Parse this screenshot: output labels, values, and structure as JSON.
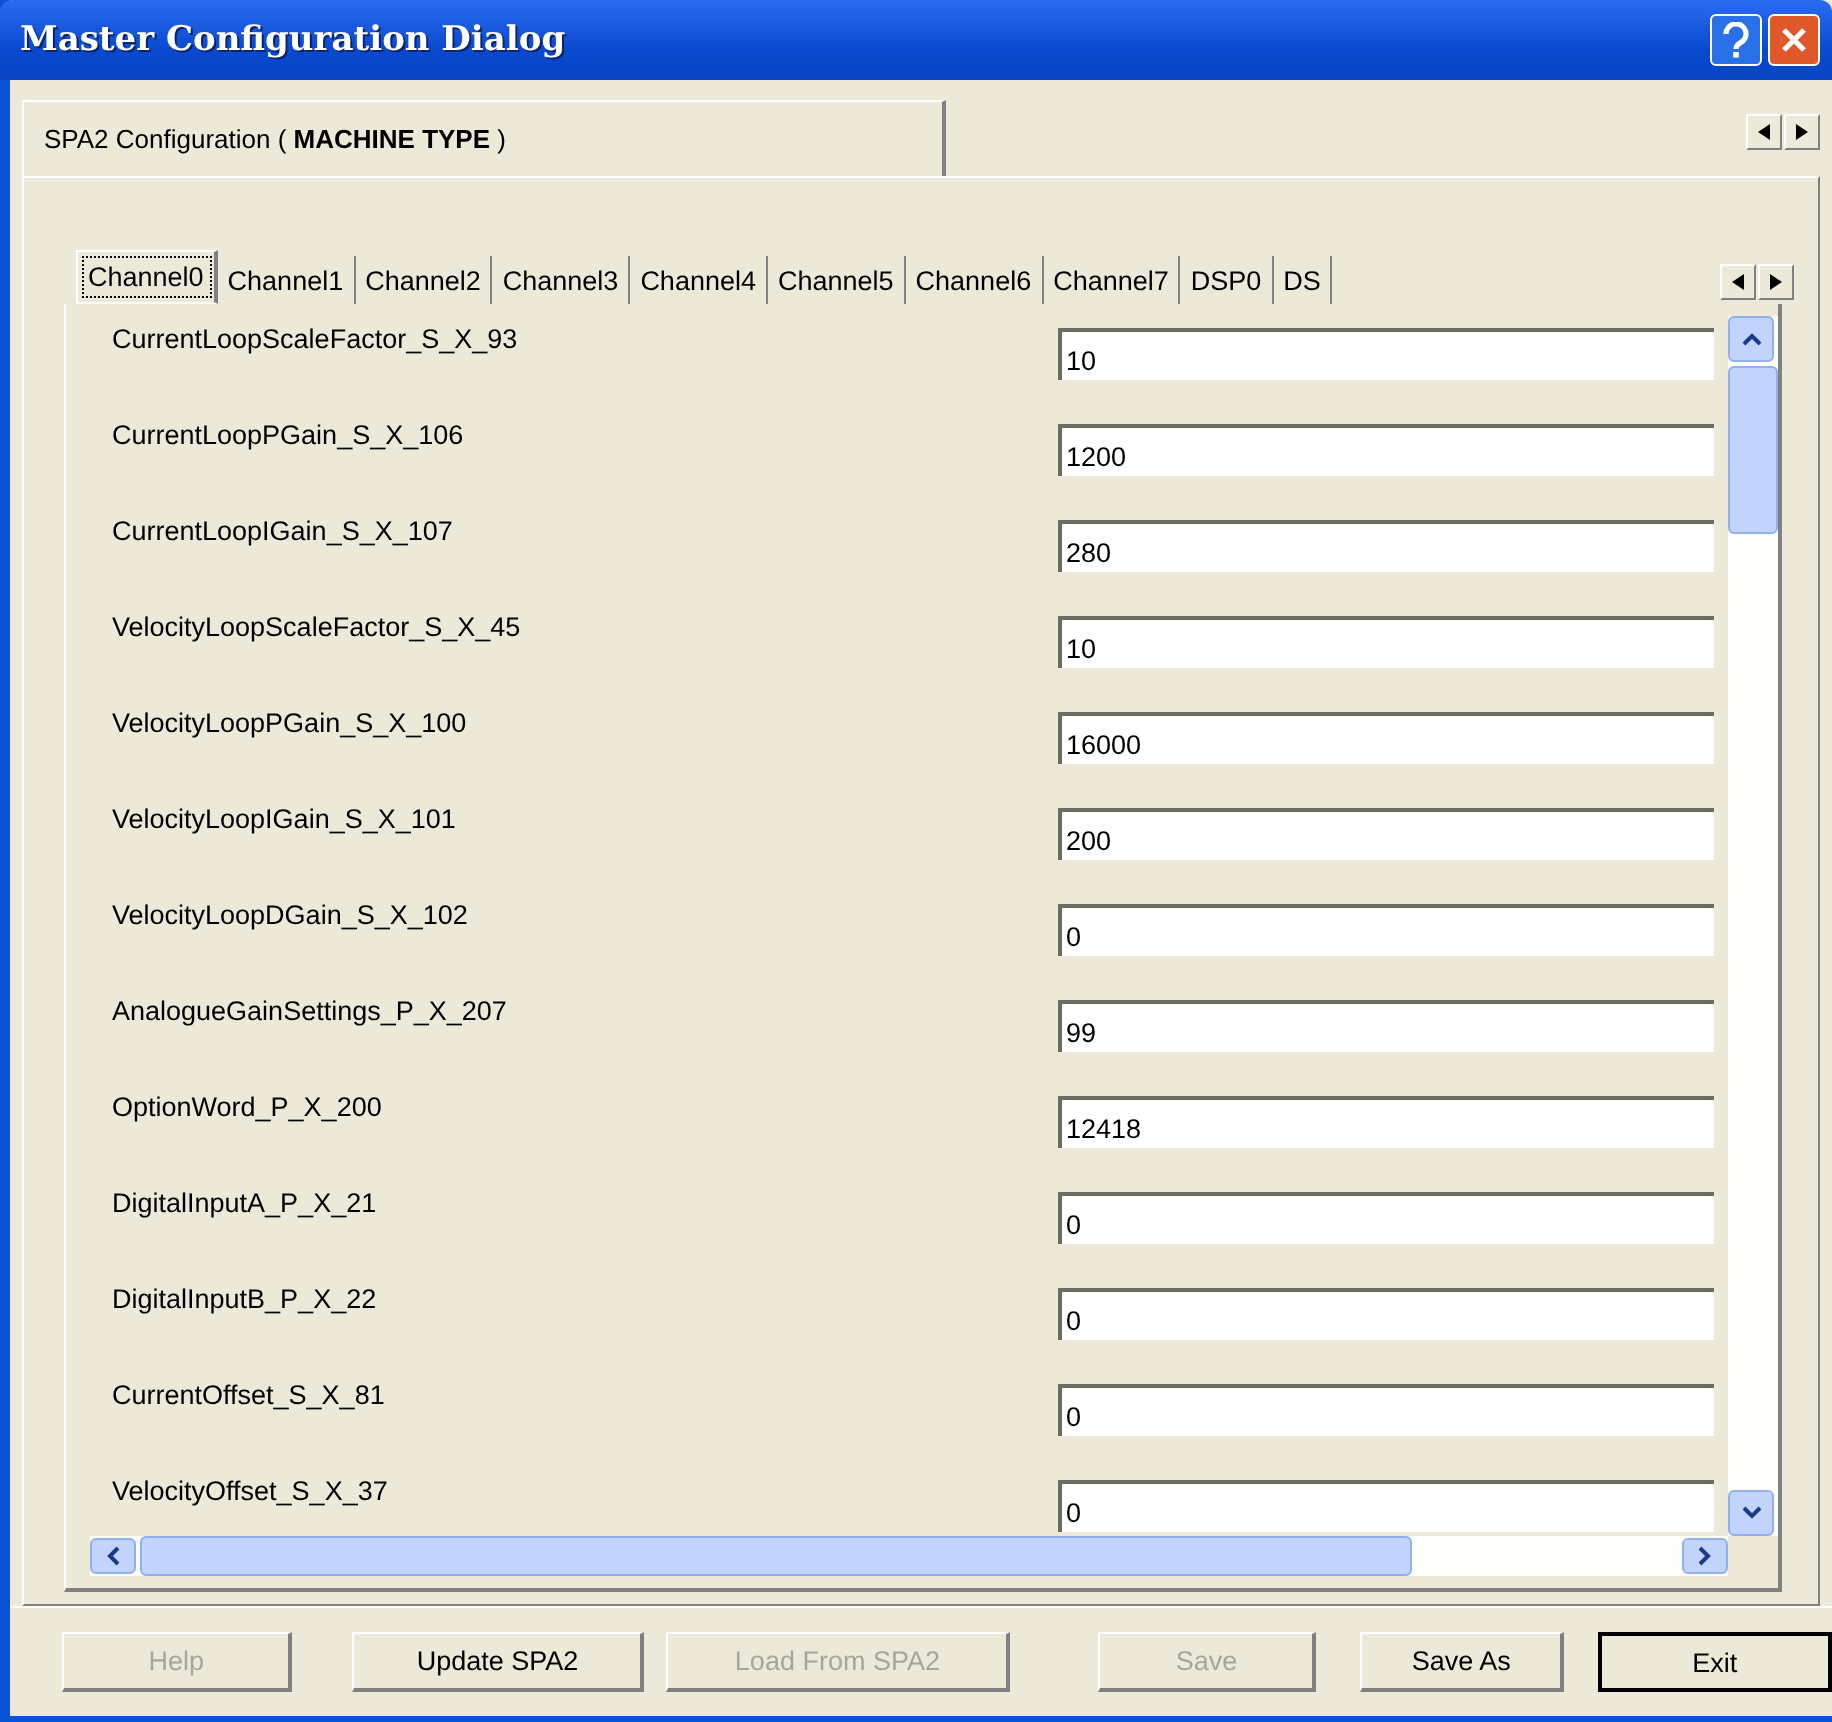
{
  "window": {
    "title": "Master Configuration Dialog"
  },
  "outer_tabs": [
    {
      "label": "SPA2 Configuration (",
      "emphasis": "MACHINE TYPE",
      "suffix": ")",
      "selected": true
    }
  ],
  "tabs": [
    {
      "label": "Channel0",
      "selected": true
    },
    {
      "label": "Channel1",
      "selected": false
    },
    {
      "label": "Channel2",
      "selected": false
    },
    {
      "label": "Channel3",
      "selected": false
    },
    {
      "label": "Channel4",
      "selected": false
    },
    {
      "label": "Channel5",
      "selected": false
    },
    {
      "label": "Channel6",
      "selected": false
    },
    {
      "label": "Channel7",
      "selected": false
    },
    {
      "label": "DSP0",
      "selected": false
    },
    {
      "label": "DS",
      "selected": false
    }
  ],
  "parameters": [
    {
      "name": "CurrentLoopScaleFactor_S_X_93",
      "value": "10"
    },
    {
      "name": "CurrentLoopPGain_S_X_106",
      "value": "1200"
    },
    {
      "name": "CurrentLoopIGain_S_X_107",
      "value": "280"
    },
    {
      "name": "VelocityLoopScaleFactor_S_X_45",
      "value": "10"
    },
    {
      "name": "VelocityLoopPGain_S_X_100",
      "value": "16000"
    },
    {
      "name": "VelocityLoopIGain_S_X_101",
      "value": "200"
    },
    {
      "name": "VelocityLoopDGain_S_X_102",
      "value": "0"
    },
    {
      "name": "AnalogueGainSettings_P_X_207",
      "value": "99"
    },
    {
      "name": "OptionWord_P_X_200",
      "value": "12418"
    },
    {
      "name": "DigitalInputA_P_X_21",
      "value": "0"
    },
    {
      "name": "DigitalInputB_P_X_22",
      "value": "0"
    },
    {
      "name": "CurrentOffset_S_X_81",
      "value": "0"
    },
    {
      "name": "VelocityOffset_S_X_37",
      "value": "0"
    }
  ],
  "buttons": [
    {
      "label": "Help",
      "disabled": true,
      "default": false
    },
    {
      "label": "Update SPA2",
      "disabled": false,
      "default": false
    },
    {
      "label": "Load From SPA2",
      "disabled": true,
      "default": false
    },
    {
      "label": "Save",
      "disabled": true,
      "default": false
    },
    {
      "label": "Save As",
      "disabled": false,
      "default": false
    },
    {
      "label": "Exit",
      "disabled": false,
      "default": true
    }
  ]
}
